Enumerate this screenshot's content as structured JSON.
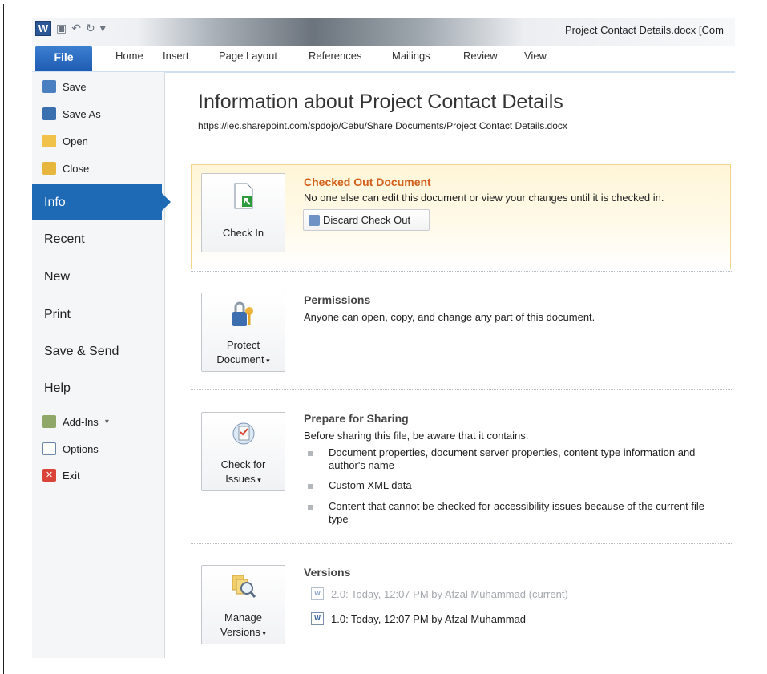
{
  "window": {
    "title": "Project Contact Details.docx [Com",
    "app_logo": "W"
  },
  "ribbon_tabs": [
    "File",
    "Home",
    "Insert",
    "Page Layout",
    "References",
    "Mailings",
    "Review",
    "View"
  ],
  "backstage": {
    "commands": [
      {
        "label": "Save",
        "icon": "save-icon"
      },
      {
        "label": "Save As",
        "icon": "save-as-icon"
      },
      {
        "label": "Open",
        "icon": "open-folder-icon"
      },
      {
        "label": "Close",
        "icon": "close-folder-icon"
      }
    ],
    "nav": [
      "Info",
      "Recent",
      "New",
      "Print",
      "Save & Send",
      "Help"
    ],
    "extras": [
      {
        "label": "Add-Ins",
        "icon": "add-ins-icon",
        "has_dropdown": true
      },
      {
        "label": "Options",
        "icon": "options-icon"
      },
      {
        "label": "Exit",
        "icon": "exit-icon"
      }
    ],
    "selected": "Info"
  },
  "info": {
    "title": "Information about Project Contact Details",
    "url": "https://iec.sharepoint.com/spdojo/Cebu/Share Documents/Project Contact Details.docx",
    "checkout": {
      "button": "Check In",
      "heading": "Checked Out Document",
      "text": "No one else can edit this document or view your changes until it is checked in.",
      "discard": "Discard Check Out"
    },
    "permissions": {
      "button_line1": "Protect",
      "button_line2": "Document",
      "heading": "Permissions",
      "text": "Anyone can open, copy, and change any part of this document."
    },
    "sharing": {
      "button_line1": "Check for",
      "button_line2": "Issues",
      "heading": "Prepare for Sharing",
      "text": "Before sharing this file, be aware that it contains:",
      "bullets": [
        "Document properties, document server properties, content type information and author's name",
        "Custom XML data",
        "Content that cannot be checked for accessibility issues because of the current file type"
      ]
    },
    "versions": {
      "button_line1": "Manage",
      "button_line2": "Versions",
      "heading": "Versions",
      "items": [
        "2.0: Today, 12:07 PM by Afzal Muhammad (current)",
        "1.0: Today, 12:07 PM by Afzal Muhammad"
      ]
    }
  },
  "colors": {
    "accent": "#1e6ab5",
    "checkout_heading": "#d2601a",
    "checkout_bg": "#fff6d8"
  }
}
